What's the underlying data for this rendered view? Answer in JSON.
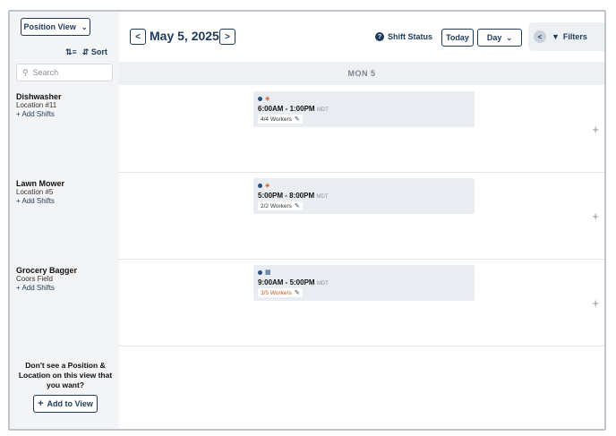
{
  "sidebar": {
    "position_view_label": "Position View",
    "sort_label": "Sort",
    "search_placeholder": "Search",
    "positions": [
      {
        "title": "Dishwasher",
        "location": "Location #11",
        "add_label": "+ Add Shifts"
      },
      {
        "title": "Lawn Mower",
        "location": "Location #5",
        "add_label": "+ Add Shifts"
      },
      {
        "title": "Grocery Bagger",
        "location": "Coors Field",
        "add_label": "+ Add Shifts"
      }
    ],
    "dont_see_text": "Don't see a Position & Location on this view that you want?",
    "add_to_view_label": "Add to View"
  },
  "header": {
    "date_title": "May 5, 2025",
    "shift_status_label": "Shift Status",
    "today_label": "Today",
    "day_label": "Day",
    "filters_label": "Filters"
  },
  "day_header": "MON 5",
  "shifts": [
    {
      "time": "6:00AM - 1:00PM",
      "tz": "MDT",
      "workers": "4/4 Workers",
      "icon": "food-icon"
    },
    {
      "time": "5:00PM - 8:00PM",
      "tz": "MDT",
      "workers": "2/2 Workers",
      "icon": "food-icon"
    },
    {
      "time": "9:00AM - 5:00PM",
      "tz": "MDT",
      "workers": "3/5 Workers",
      "icon": "calendar-icon",
      "understaffed_color": "#d0561b"
    }
  ],
  "colors": {
    "accent": "#1f3a5a",
    "dot": "#2b4f80",
    "understaffed": "#d0561b"
  }
}
